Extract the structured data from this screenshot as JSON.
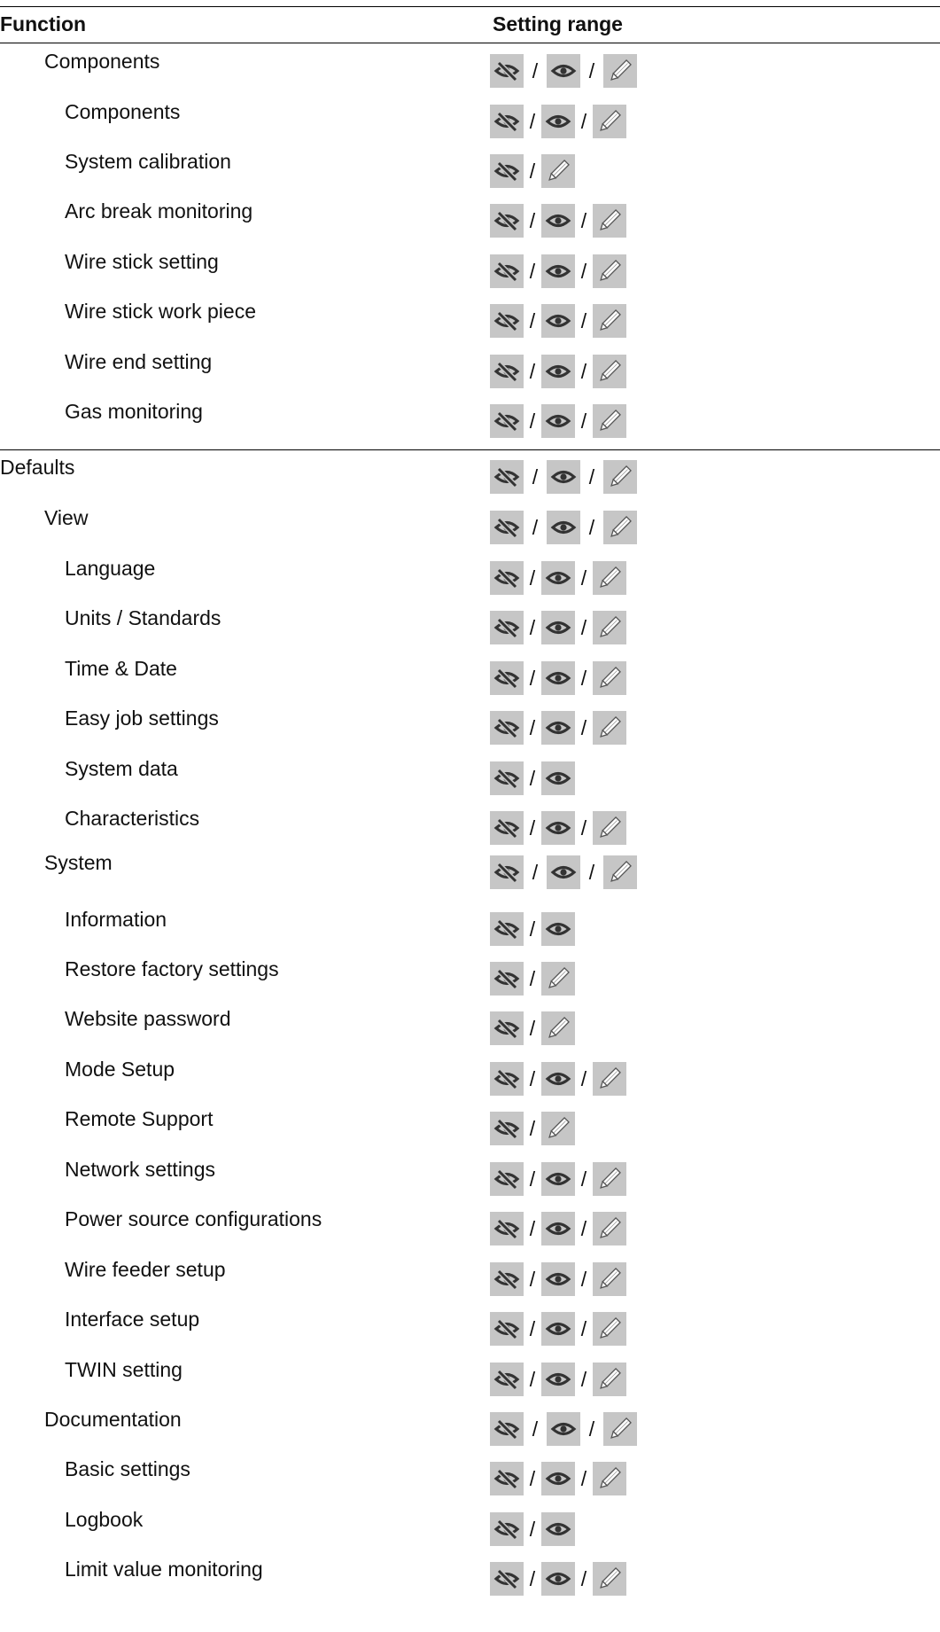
{
  "header": {
    "function": "Function",
    "setting_range": "Setting range"
  },
  "icon_names": {
    "hidden": "eye-crossed-icon",
    "view": "eye-icon",
    "edit": "pencil-icon"
  },
  "separator": "/",
  "rows": [
    {
      "label": "Components",
      "level": 1,
      "icons": [
        "hidden",
        "view",
        "edit"
      ]
    },
    {
      "label": "Components",
      "level": 2,
      "icons": [
        "hidden",
        "view",
        "edit"
      ]
    },
    {
      "label": "System calibration",
      "level": 2,
      "icons": [
        "hidden",
        "edit"
      ]
    },
    {
      "label": "Arc break monitoring",
      "level": 2,
      "icons": [
        "hidden",
        "view",
        "edit"
      ]
    },
    {
      "label": "Wire stick setting",
      "level": 2,
      "icons": [
        "hidden",
        "view",
        "edit"
      ]
    },
    {
      "label": "Wire stick work piece",
      "level": 2,
      "icons": [
        "hidden",
        "view",
        "edit"
      ]
    },
    {
      "label": "Wire end setting",
      "level": 2,
      "icons": [
        "hidden",
        "view",
        "edit"
      ]
    },
    {
      "label": "Gas monitoring",
      "level": 2,
      "icons": [
        "hidden",
        "view",
        "edit"
      ]
    },
    {
      "label": "Defaults",
      "level": 0,
      "icons": [
        "hidden",
        "view",
        "edit"
      ]
    },
    {
      "label": "View",
      "level": 1,
      "icons": [
        "hidden",
        "view",
        "edit"
      ]
    },
    {
      "label": "Language",
      "level": 2,
      "icons": [
        "hidden",
        "view",
        "edit"
      ]
    },
    {
      "label": "Units / Standards",
      "level": 2,
      "icons": [
        "hidden",
        "view",
        "edit"
      ]
    },
    {
      "label": "Time & Date",
      "level": 2,
      "icons": [
        "hidden",
        "view",
        "edit"
      ]
    },
    {
      "label": "Easy job settings",
      "level": 2,
      "icons": [
        "hidden",
        "view",
        "edit"
      ]
    },
    {
      "label": "System data",
      "level": 2,
      "icons": [
        "hidden",
        "view"
      ]
    },
    {
      "label": "Characteristics",
      "level": 2,
      "icons": [
        "hidden",
        "view",
        "edit"
      ]
    },
    {
      "label": "System",
      "level": 1,
      "icons": [
        "hidden",
        "view",
        "edit"
      ]
    },
    {
      "label": "Information",
      "level": 2,
      "icons": [
        "hidden",
        "view"
      ]
    },
    {
      "label": "Restore factory settings",
      "level": 2,
      "icons": [
        "hidden",
        "edit"
      ]
    },
    {
      "label": "Website password",
      "level": 2,
      "icons": [
        "hidden",
        "edit"
      ]
    },
    {
      "label": "Mode Setup",
      "level": 2,
      "icons": [
        "hidden",
        "view",
        "edit"
      ]
    },
    {
      "label": "Remote Support",
      "level": 2,
      "icons": [
        "hidden",
        "edit"
      ]
    },
    {
      "label": "Network settings",
      "level": 2,
      "icons": [
        "hidden",
        "view",
        "edit"
      ]
    },
    {
      "label": "Power source configurations",
      "level": 2,
      "icons": [
        "hidden",
        "view",
        "edit"
      ]
    },
    {
      "label": "Wire feeder setup",
      "level": 2,
      "icons": [
        "hidden",
        "view",
        "edit"
      ]
    },
    {
      "label": "Interface setup",
      "level": 2,
      "icons": [
        "hidden",
        "view",
        "edit"
      ]
    },
    {
      "label": "TWIN setting",
      "level": 2,
      "icons": [
        "hidden",
        "view",
        "edit"
      ]
    },
    {
      "label": "Documentation",
      "level": 1,
      "icons": [
        "hidden",
        "view",
        "edit"
      ]
    },
    {
      "label": "Basic settings",
      "level": 2,
      "icons": [
        "hidden",
        "view",
        "edit"
      ]
    },
    {
      "label": "Logbook",
      "level": 2,
      "icons": [
        "hidden",
        "view"
      ]
    },
    {
      "label": "Limit value monitoring",
      "level": 2,
      "icons": [
        "hidden",
        "view",
        "edit"
      ]
    }
  ]
}
